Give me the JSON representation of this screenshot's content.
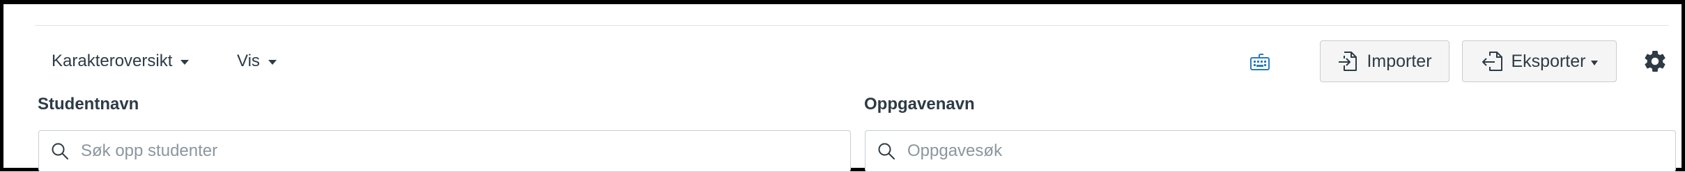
{
  "toolbar": {
    "overview_menu_label": "Karakteroversikt",
    "view_menu_label": "Vis",
    "import_label": "Importer",
    "export_label": "Eksporter",
    "keyboard_icon": "keyboard-icon",
    "settings_icon": "gear-icon"
  },
  "filters": {
    "student": {
      "label": "Studentnavn",
      "placeholder": "Søk opp studenter",
      "value": ""
    },
    "assignment": {
      "label": "Oppgavenavn",
      "placeholder": "Oppgavesøk",
      "value": ""
    }
  },
  "colors": {
    "text": "#2d3b45",
    "border": "#c7cdd1",
    "button_bg": "#f5f5f5",
    "keyboard_icon": "#2b7abc",
    "placeholder": "#8b969e"
  }
}
